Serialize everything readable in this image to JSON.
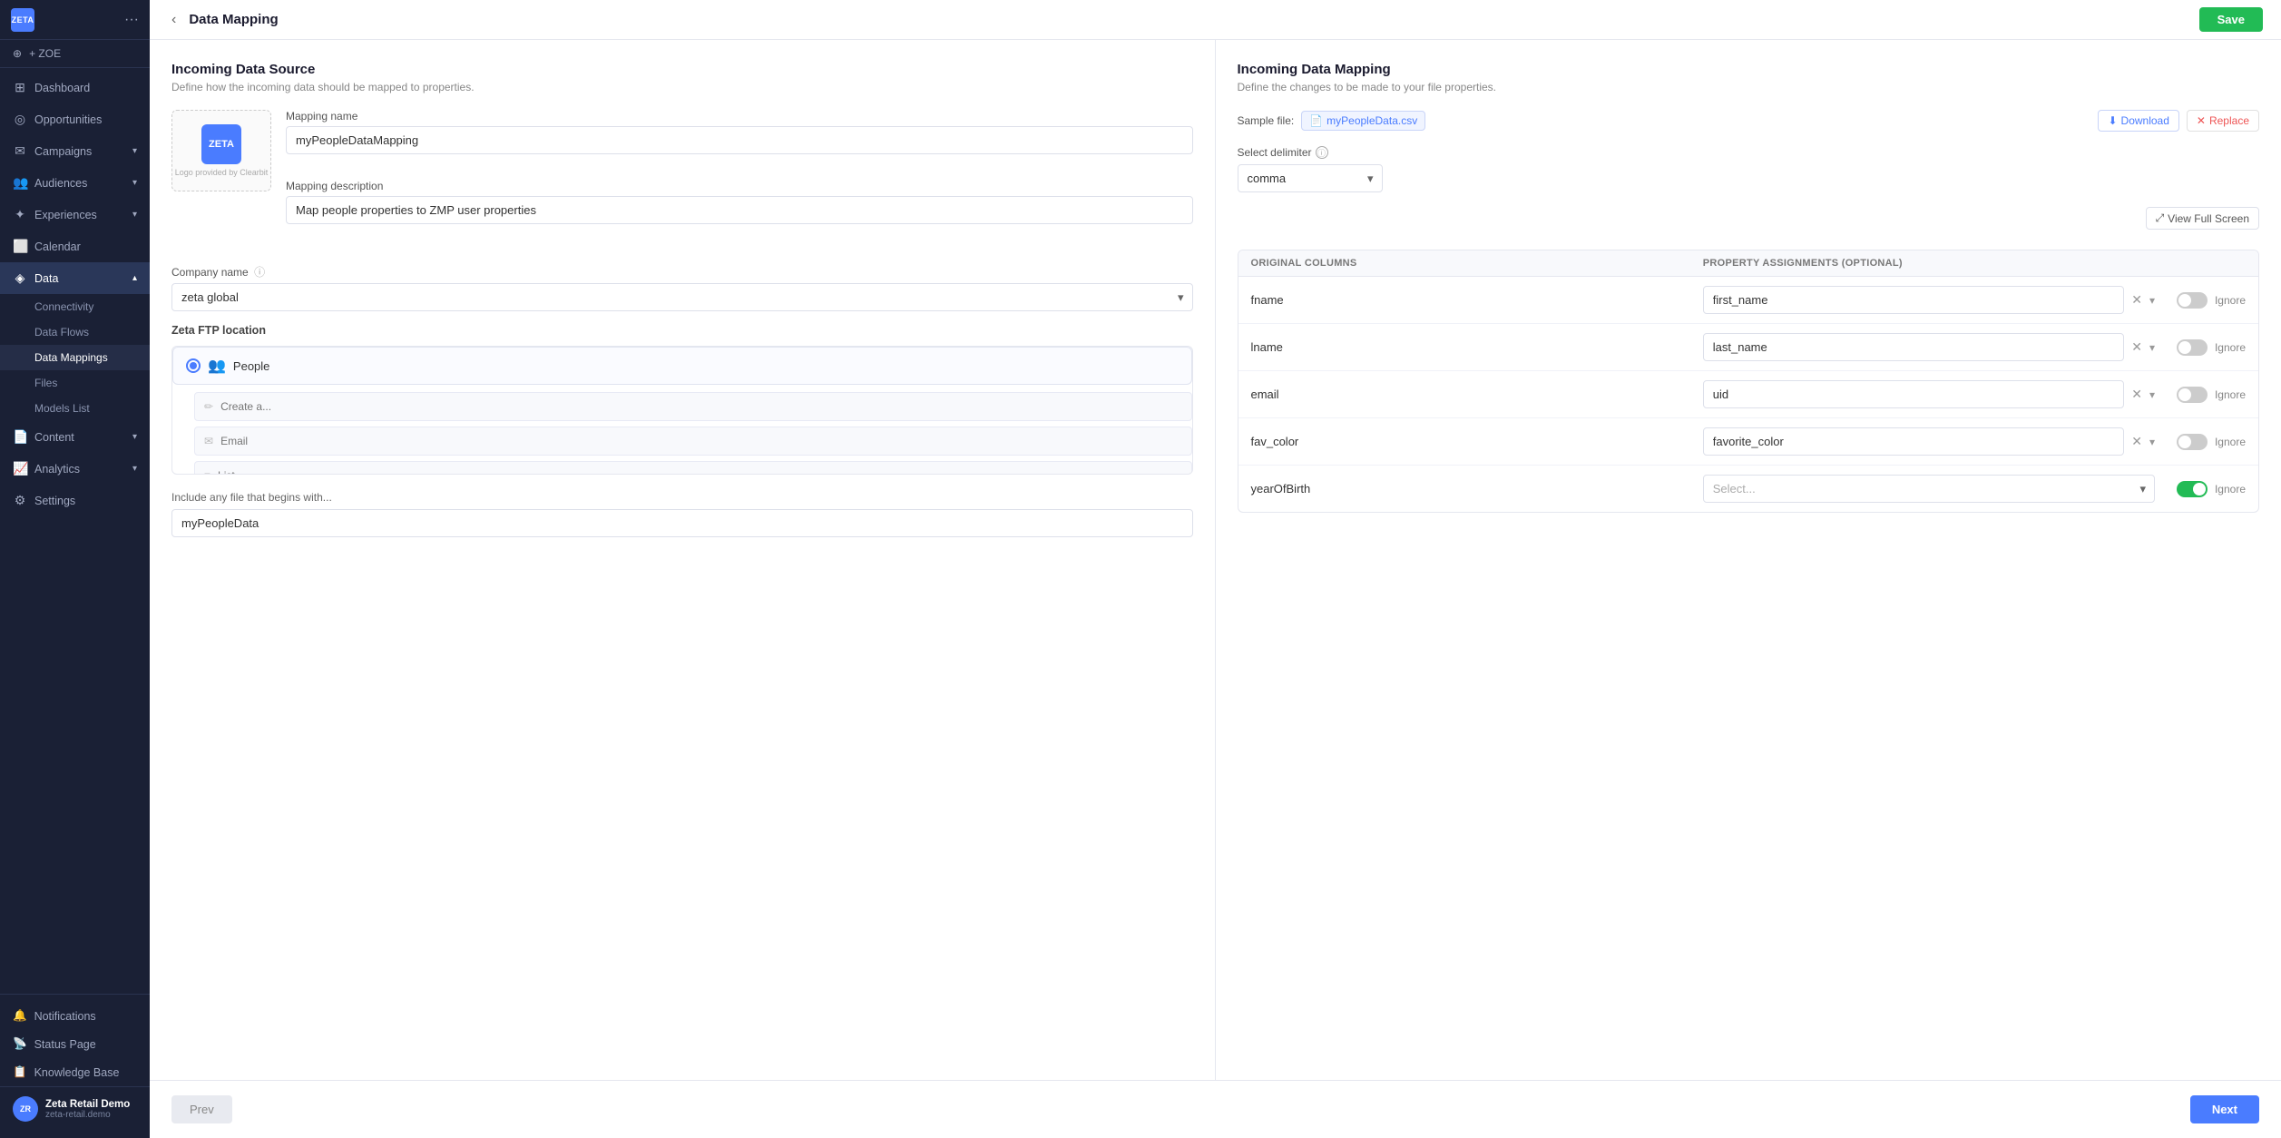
{
  "app": {
    "logo": "ZETA",
    "name": "ZETA"
  },
  "sidebar": {
    "zoe_label": "+ ZOE",
    "nav_items": [
      {
        "id": "dashboard",
        "label": "Dashboard",
        "icon": "⊞",
        "has_arrow": false
      },
      {
        "id": "opportunities",
        "label": "Opportunities",
        "icon": "◎",
        "has_arrow": false
      },
      {
        "id": "campaigns",
        "label": "Campaigns",
        "icon": "✉",
        "has_arrow": true
      },
      {
        "id": "audiences",
        "label": "Audiences",
        "icon": "👥",
        "has_arrow": true
      },
      {
        "id": "experiences",
        "label": "Experiences",
        "icon": "✦",
        "has_arrow": true
      },
      {
        "id": "calendar",
        "label": "Calendar",
        "icon": "📅",
        "has_arrow": false
      },
      {
        "id": "data",
        "label": "Data",
        "icon": "📊",
        "has_arrow": true,
        "active": true
      }
    ],
    "data_sub_items": [
      {
        "id": "connectivity",
        "label": "Connectivity"
      },
      {
        "id": "data-flows",
        "label": "Data Flows"
      },
      {
        "id": "data-mappings",
        "label": "Data Mappings",
        "active": true
      },
      {
        "id": "files",
        "label": "Files"
      },
      {
        "id": "models-list",
        "label": "Models List"
      }
    ],
    "nav_items_2": [
      {
        "id": "content",
        "label": "Content",
        "icon": "📄",
        "has_arrow": true
      },
      {
        "id": "analytics",
        "label": "Analytics",
        "icon": "📈",
        "has_arrow": true
      },
      {
        "id": "settings",
        "label": "Settings",
        "icon": "⚙",
        "has_arrow": false
      }
    ],
    "bottom_items": [
      {
        "id": "notifications",
        "label": "Notifications",
        "icon": "🔔"
      },
      {
        "id": "status-page",
        "label": "Status Page",
        "icon": "📡"
      },
      {
        "id": "knowledge-base",
        "label": "Knowledge Base",
        "icon": "📋"
      }
    ],
    "user": {
      "name": "Zeta Retail Demo",
      "email": "zeta-retail.demo",
      "initials": "ZR"
    }
  },
  "topbar": {
    "back_label": "‹",
    "title": "Data Mapping",
    "save_label": "Save"
  },
  "left_panel": {
    "title": "Incoming Data Source",
    "description": "Define how the incoming data should be mapped to properties.",
    "mapping_name_label": "Mapping name",
    "mapping_name_value": "myPeopleDataMapping",
    "mapping_desc_label": "Mapping description",
    "mapping_desc_value": "Map people properties to ZMP user properties",
    "company_name_label": "Company name",
    "company_name_value": "zeta global",
    "ftp_label": "Zeta FTP location",
    "ftp_items": [
      {
        "id": "people",
        "label": "People",
        "selected": true
      }
    ],
    "ftp_sub_rows": [
      {
        "placeholder": "Create a...",
        "icon": "✏"
      },
      {
        "placeholder": "Email",
        "icon": "✉"
      },
      {
        "placeholder": "List",
        "icon": "≡"
      }
    ],
    "include_label": "Include any file that begins with...",
    "include_value": "myPeopleData"
  },
  "right_panel": {
    "title": "Incoming Data Mapping",
    "description": "Define the changes to be made to your file properties.",
    "sample_file_label": "Sample file:",
    "sample_file_name": "myPeopleData.csv",
    "download_label": "Download",
    "replace_label": "Replace",
    "delimiter_label": "Select delimiter",
    "delimiter_value": "comma",
    "view_full_screen_label": "View Full Screen",
    "mapping_table": {
      "col1_header": "Original Columns",
      "col2_header": "Property Assignments (optional)",
      "col3_header": "",
      "rows": [
        {
          "original": "fname",
          "assigned": "first_name",
          "has_value": true,
          "ignore": false
        },
        {
          "original": "lname",
          "assigned": "last_name",
          "has_value": true,
          "ignore": false
        },
        {
          "original": "email",
          "assigned": "uid",
          "has_value": true,
          "ignore": false
        },
        {
          "original": "fav_color",
          "assigned": "favorite_color",
          "has_value": true,
          "ignore": false
        },
        {
          "original": "yearOfBirth",
          "assigned": "",
          "has_value": false,
          "ignore": true
        }
      ],
      "ignore_label": "Ignore"
    }
  },
  "buttons": {
    "prev_label": "Prev",
    "next_label": "Next"
  }
}
